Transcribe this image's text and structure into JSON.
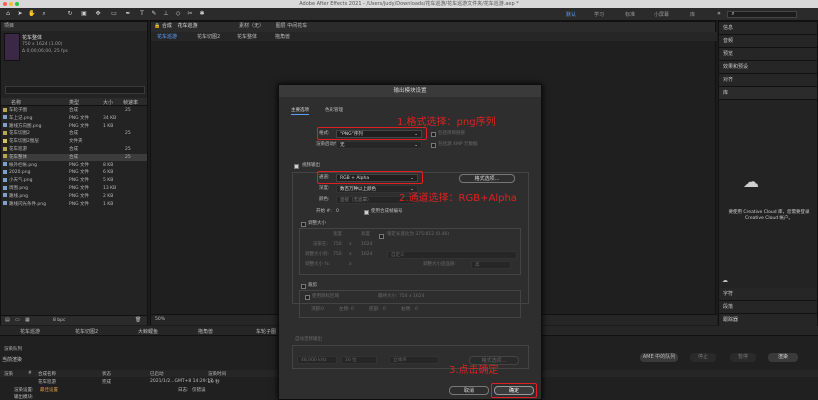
{
  "window": {
    "title": "Adobe After Effects 2021 - /Users/judy/Downloads/花车巡游/花车巡游文件夹/花车巡游.aep *"
  },
  "workspaces": [
    "默认",
    "学习",
    "标准",
    "小屏幕",
    "库"
  ],
  "viewer": {
    "comp_label": "合成",
    "comp_name": "花车巡游",
    "material": "素材（无）",
    "layer": "图层 中间花车",
    "tabs": [
      "花车巡游",
      "花车切图2",
      "花车整体",
      "拖角兽"
    ]
  },
  "project": {
    "header": "项目",
    "preview_name": "花车整体",
    "preview_info": [
      "750 x 1624 (1.00)",
      "Δ 0;00;06;00, 25 fps"
    ],
    "columns": [
      "名称",
      "类型",
      "大小",
      "帧速率"
    ],
    "items": [
      {
        "name": "车轮子图",
        "type": "合成",
        "size": "",
        "fps": "25",
        "color": "#b9a35a"
      },
      {
        "name": "车上记.png",
        "type": "PNG 文件",
        "size": "34 KB",
        "fps": "",
        "color": "#7fa0c8"
      },
      {
        "name": "路线方向图.png",
        "type": "PNG 文件",
        "size": "1 KB",
        "fps": "",
        "color": "#7fa0c8"
      },
      {
        "name": "花车切图2",
        "type": "合成",
        "size": "",
        "fps": "25",
        "color": "#b9a35a"
      },
      {
        "name": "花车切图2图层",
        "type": "文件夹",
        "size": "",
        "fps": "",
        "color": "#d6c16a"
      },
      {
        "name": "花车巡游",
        "type": "合成",
        "size": "",
        "fps": "25",
        "color": "#b9a35a"
      },
      {
        "name": "花车整体",
        "type": "合成",
        "size": "",
        "fps": "25",
        "color": "#b9a35a"
      },
      {
        "name": "帐外栏帐.png",
        "type": "PNG 文件",
        "size": "8 KB",
        "fps": "",
        "color": "#7fa0c8"
      },
      {
        "name": "2020.png",
        "type": "PNG 文件",
        "size": "6 KB",
        "fps": "",
        "color": "#7fa0c8"
      },
      {
        "name": "小天气.png",
        "type": "PNG 文件",
        "size": "5 KB",
        "fps": "",
        "color": "#7fa0c8"
      },
      {
        "name": "周围.png",
        "type": "PNG 文件",
        "size": "13 KB",
        "fps": "",
        "color": "#7fa0c8"
      },
      {
        "name": "路线.png",
        "type": "PNG 文件",
        "size": "2 KB",
        "fps": "",
        "color": "#7fa0c8"
      },
      {
        "name": "路线闪光条件.png",
        "type": "PNG 文件",
        "size": "1 KB",
        "fps": "",
        "color": "#7fa0c8"
      }
    ],
    "bpc": "8 bpc"
  },
  "right_panel": {
    "items": [
      "信息",
      "音频",
      "预览",
      "效果和预设",
      "对齐",
      "库"
    ],
    "search_placeholder": "搜索库",
    "cc_message": "要使用 Creative Cloud 库，您需要登录 Creative Cloud 帐户。",
    "bottom_items": [
      "字符",
      "段落",
      "跟踪器"
    ]
  },
  "dialog": {
    "title": "输出模块设置",
    "tabs": [
      "主要选项",
      "色彩管理"
    ],
    "format_label": "格式:",
    "format_value": "\"PNG\"序列",
    "post_render_label": "渲染后动作:",
    "post_render_value": "无",
    "include_project_link": "包括项目链接",
    "include_xmp": "包括源 XMP 元数据",
    "video_output": "视频输出",
    "channels_label": "通道:",
    "channels_value": "RGB + Alpha",
    "format_options": "格式选项...",
    "depth_label": "深度:",
    "depth_value": "数百万种以上颜色",
    "color_label": "颜色:",
    "color_value": "直接（无遮罩）",
    "start_label": "开始 #:",
    "start_value": "0",
    "use_comp_frame": "使用合成帧编号",
    "resize": "调整大小",
    "resize_width_h": "宽度",
    "resize_height_h": "高度",
    "lock_ratio": "锁定长宽比为 375:812 (0.46)",
    "render_at": "渲染在:",
    "resize_to": "调整大小到:",
    "resize_pct": "调整大小 %:",
    "w750": "750",
    "h1624": "1624",
    "x_sym": "x",
    "custom": "自定义",
    "resize_quality": "调整大小后品质:",
    "quality": "高",
    "crop": "裁剪",
    "use_roi": "使用目标区域",
    "final_size": "最终大小: 750 x 1624",
    "top_label": "顶部:",
    "left_label": "左侧:",
    "bottom_label": "底部:",
    "right_label": "右侧:",
    "zero": "0",
    "audio_auto": "自动音频输出",
    "audio_rate": "48,000 kHz",
    "audio_bits": "16 位",
    "audio_stereo": "立体声",
    "audio_format_options": "格式选项...",
    "cancel": "取消",
    "ok": "确定"
  },
  "annotations": {
    "step1": "1.格式选择：png序列",
    "step2": "2.通道选择：RGB+Alpha",
    "step3": "3.点击确定"
  },
  "timeline": {
    "tabs": [
      "花车巡游",
      "花车切图2",
      "大鲸鲤鱼",
      "拖角兽",
      "车轮子图"
    ],
    "render_queue": "渲染队列",
    "current_render": "当前渲染",
    "columns": [
      "渲染",
      "#",
      "合成名称",
      "状态",
      "已启动",
      "渲染时间"
    ],
    "row1": {
      "name": "花车巡游",
      "status": "完成",
      "started": "2021/1/2...GMT+8 14:29:17",
      "time": "29 秒"
    },
    "render_settings_label": "渲染设置:",
    "render_settings_value": "最佳设置",
    "log_label": "日志:",
    "log_value": "仅错误",
    "output_module_label": "输出模块:",
    "ame_queue": "AME 中的队列",
    "stop": "停止",
    "pause": "暂停",
    "render": "渲染",
    "message_label": "消息:",
    "ram_label": "RAM:",
    "render_start": "渲染已开始:",
    "elapsed": "已用总时间:"
  },
  "zoom": "50%"
}
